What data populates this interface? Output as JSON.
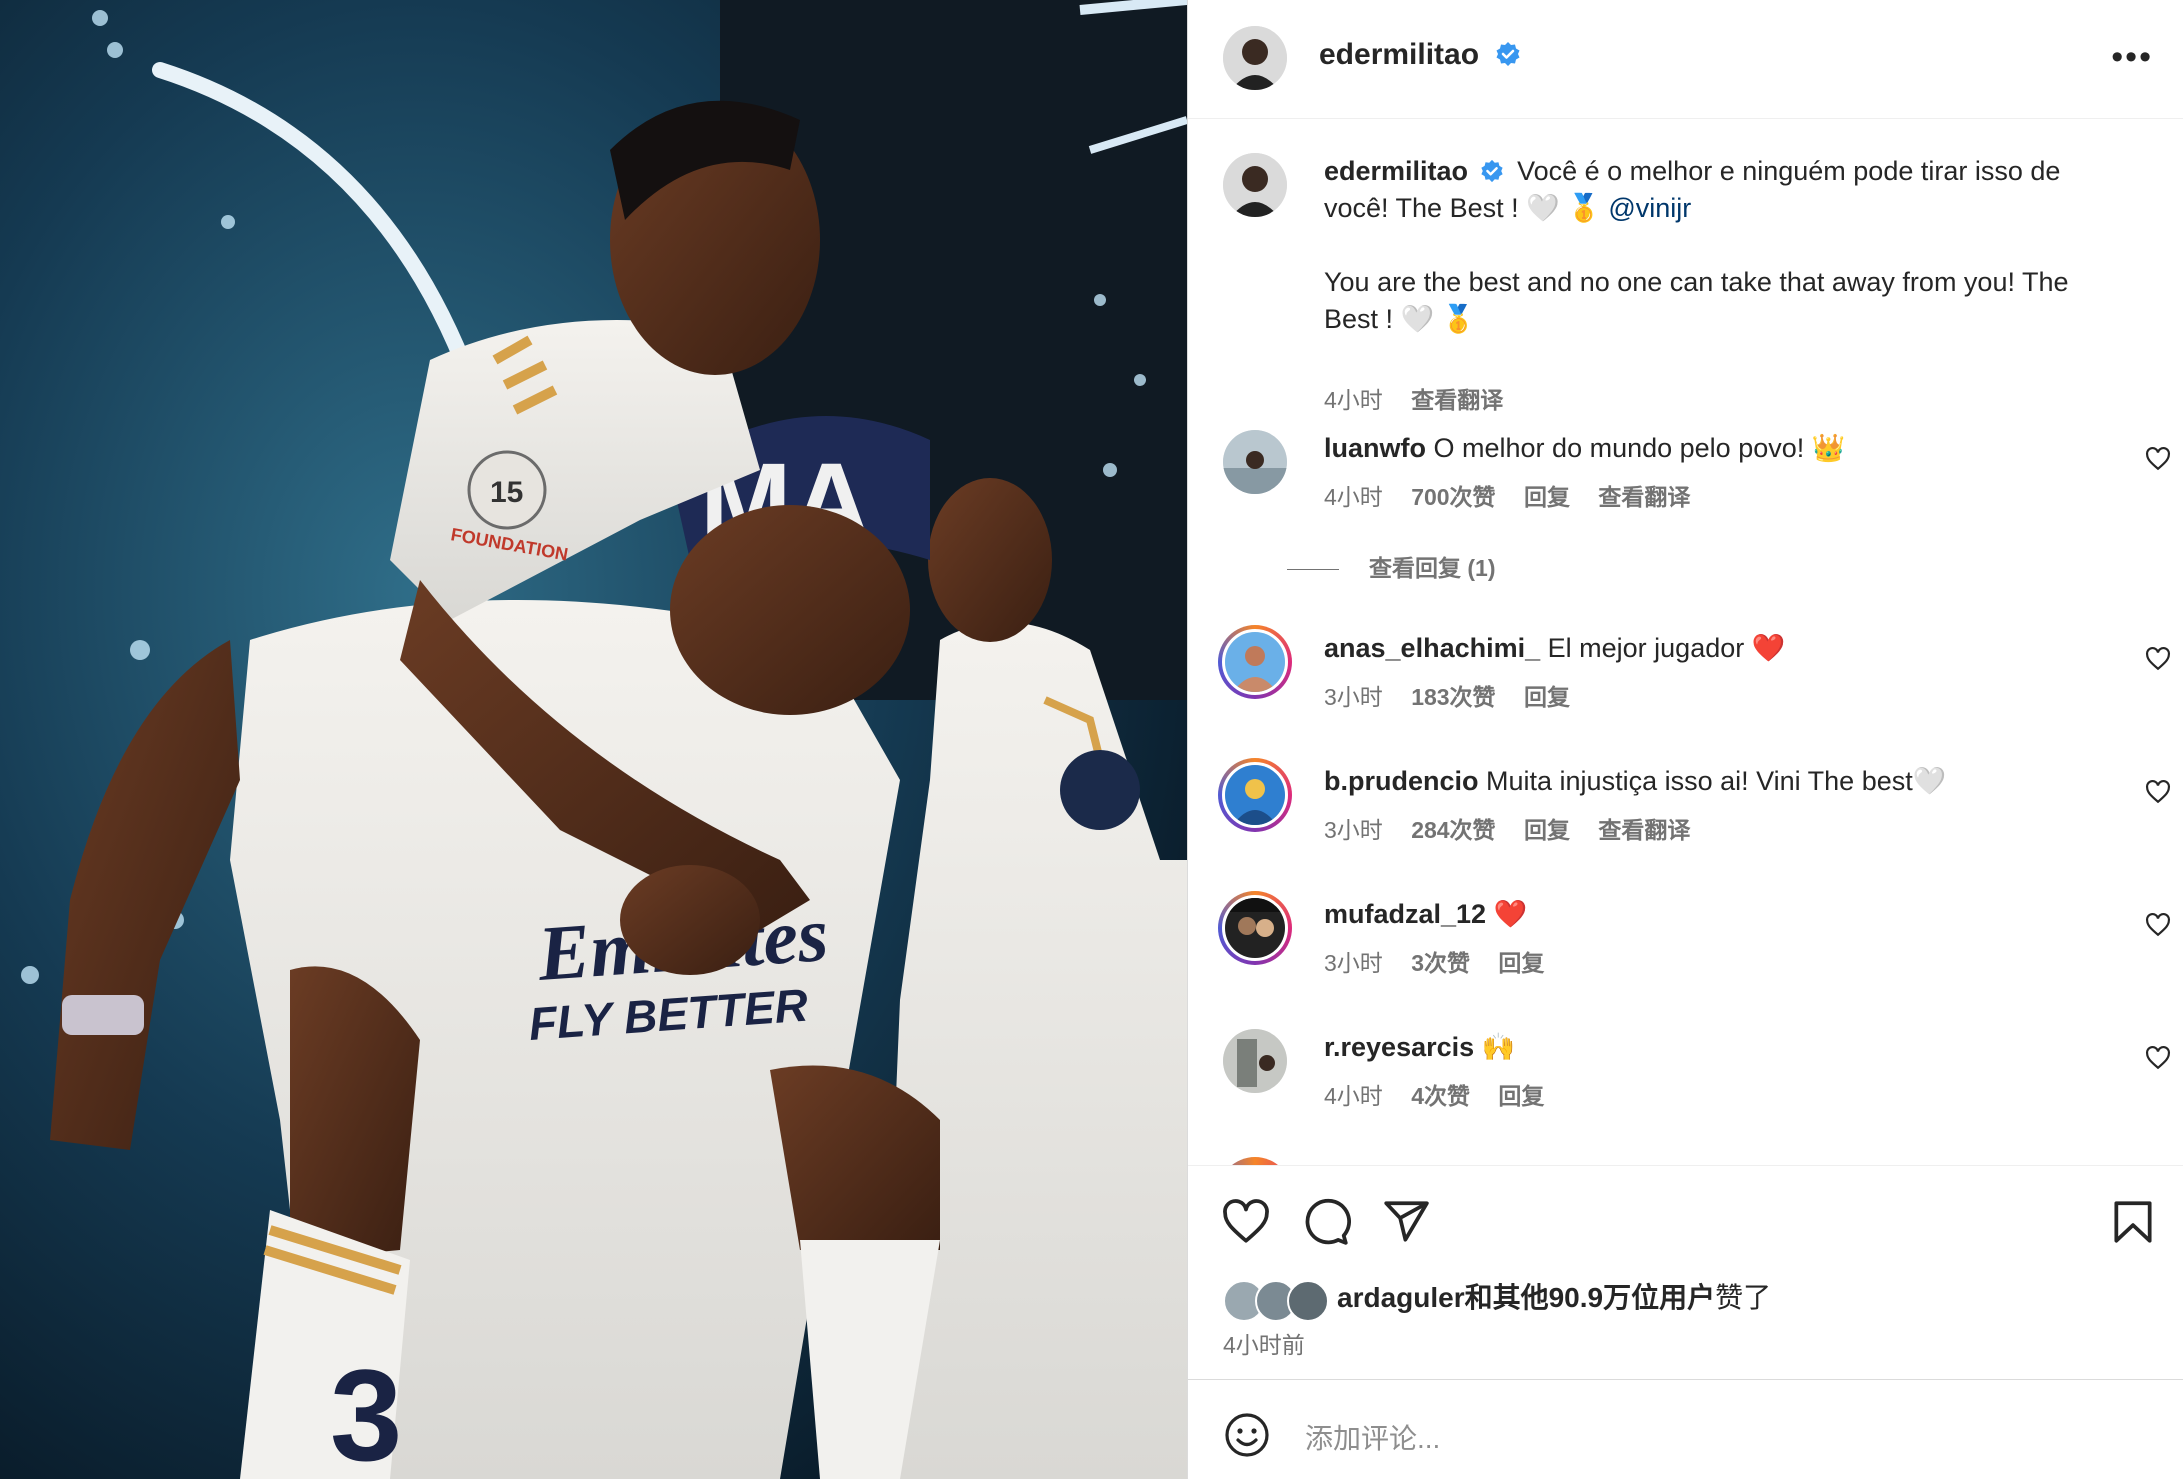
{
  "post": {
    "author": "edermilitao",
    "more_label": "•••"
  },
  "caption": {
    "username": "edermilitao",
    "text_pt": "Você é o melhor e ninguém pode tirar isso de você! The Best ! 🤍 🥇",
    "mention": "@vinijr",
    "text_en": "You are the best and no one can take that away from you! The Best ! 🤍 🥇",
    "time": "4小时",
    "translate": "查看翻译"
  },
  "comments": [
    {
      "user": "luanwfo",
      "text": "O melhor do mundo pelo povo! 👑",
      "time": "4小时",
      "likes": "700次赞",
      "reply": "回复",
      "translate": "查看翻译",
      "view_replies": "查看回复 (1)"
    },
    {
      "user": "anas_elhachimi_",
      "text": "El mejor jugador ❤️",
      "time": "3小时",
      "likes": "183次赞",
      "reply": "回复"
    },
    {
      "user": "b.prudencio",
      "text": "Muita injustiça isso ai! Vini The best🤍",
      "time": "3小时",
      "likes": "284次赞",
      "reply": "回复",
      "translate": "查看翻译"
    },
    {
      "user": "mufadzal_12",
      "text": "❤️",
      "time": "3小时",
      "likes": "3次赞",
      "reply": "回复"
    },
    {
      "user": "r.reyesarcis",
      "text": "🙌",
      "time": "4小时",
      "likes": "4次赞",
      "reply": "回复"
    }
  ],
  "likes_summary": {
    "user": "ardaguler",
    "rest": "和其他90.9万位用户",
    "suffix": "赞了"
  },
  "posted_ago": "4小时前",
  "add_comment": {
    "placeholder": "添加评论..."
  },
  "photo": {
    "headband_text": "MA",
    "sponsor_line1": "Emirates",
    "sponsor_line2": "FLY BETTER",
    "number": "3",
    "patch_text": "15",
    "sleeve_text": "FOUNDATION"
  },
  "colors": {
    "verified": "#3897f0",
    "mention": "#00376b",
    "heart_red": "#ed4956",
    "meta_gray": "#737373"
  }
}
